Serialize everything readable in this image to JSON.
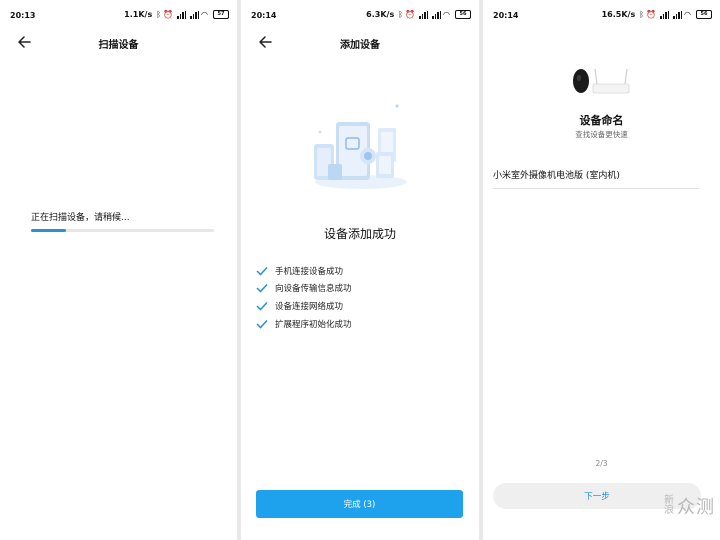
{
  "screens": [
    {
      "status": {
        "time": "20:13",
        "speed": "1.1K/s",
        "battery": "57"
      },
      "title": "扫描设备",
      "scan_text": "正在扫描设备，请稍候...",
      "progress": 0.19
    },
    {
      "status": {
        "time": "20:14",
        "speed": "6.3K/s",
        "battery": "56"
      },
      "title": "添加设备",
      "success_title": "设备添加成功",
      "steps": [
        "手机连接设备成功",
        "向设备传输信息成功",
        "设备连接网络成功",
        "扩展程序初始化成功"
      ],
      "done_button": "完成 (3)"
    },
    {
      "status": {
        "time": "20:14",
        "speed": "16.5K/s",
        "battery": "56"
      },
      "name_title": "设备命名",
      "name_subtitle": "查找设备更快速",
      "device_name": "小米室外摄像机电池版 (室内机)",
      "page_indicator": "2/3",
      "next_button": "下一步"
    }
  ],
  "watermark": {
    "part1": "新浪",
    "part2": "众测"
  },
  "colors": {
    "accent": "#1fa2ee",
    "progress": "#2c8fd7",
    "link": "#1f8fdf"
  },
  "icons": [
    "bluetooth-icon",
    "alarm-icon",
    "signal-icon",
    "wifi-icon",
    "battery-icon",
    "back-arrow-icon",
    "check-icon"
  ]
}
